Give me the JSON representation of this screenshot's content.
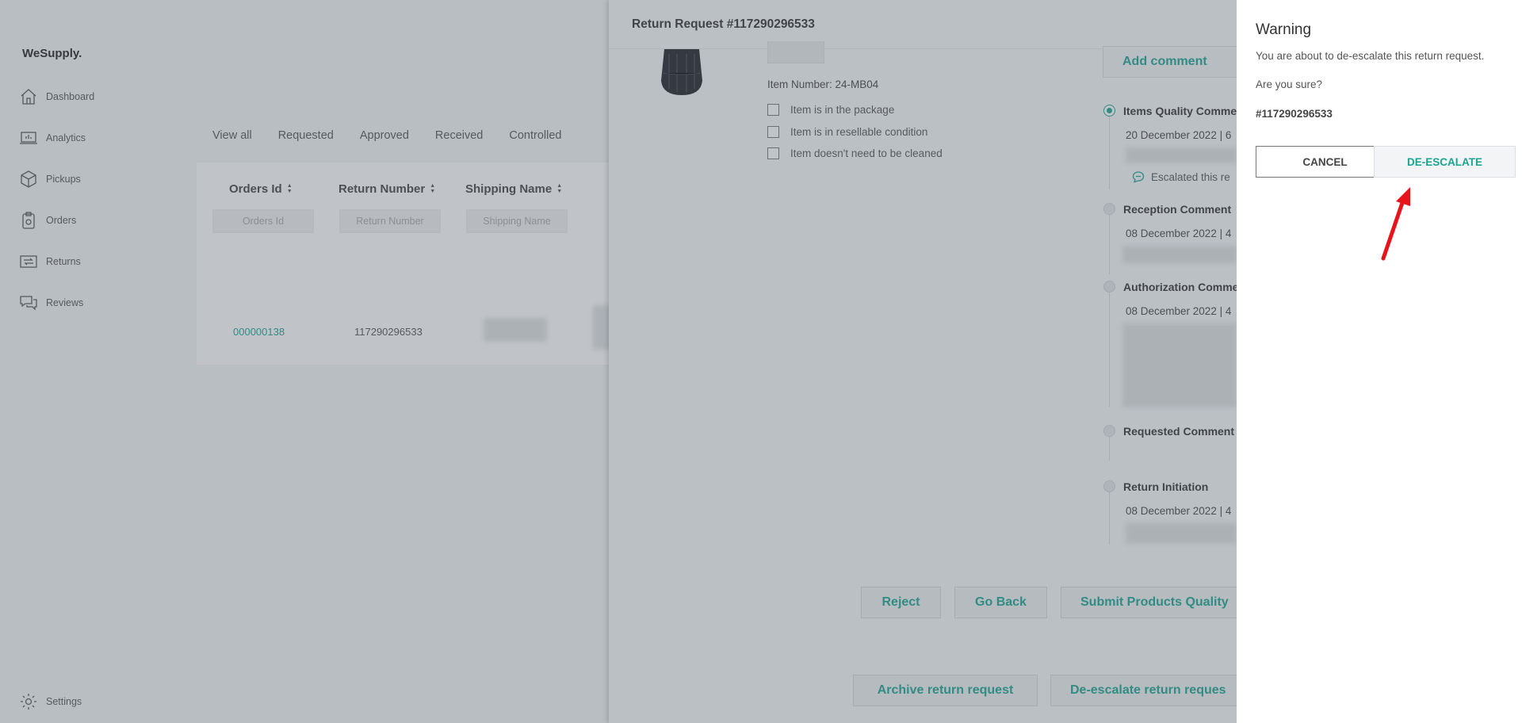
{
  "brand": "WeSupply.",
  "sidebar": {
    "items": [
      {
        "label": "Dashboard",
        "icon": "home-icon"
      },
      {
        "label": "Analytics",
        "icon": "analytics-icon"
      },
      {
        "label": "Pickups",
        "icon": "box-icon"
      },
      {
        "label": "Orders",
        "icon": "clipboard-icon"
      },
      {
        "label": "Returns",
        "icon": "returns-icon"
      },
      {
        "label": "Reviews",
        "icon": "reviews-icon"
      }
    ],
    "settings_label": "Settings"
  },
  "main": {
    "tabs": [
      "View all",
      "Requested",
      "Approved",
      "Received",
      "Controlled"
    ],
    "table": {
      "columns": [
        "Orders Id",
        "Return Number",
        "Shipping Name"
      ],
      "filter_placeholders": [
        "Orders Id",
        "Return Number",
        "Shipping Name"
      ],
      "row": {
        "order_id": "000000138",
        "return_number": "117290296533"
      }
    }
  },
  "panel": {
    "title": "Return Request #117290296533",
    "item_number": "Item Number: 24-MB04",
    "checks": [
      "Item is in the package",
      "Item is in resellable condition",
      "Item doesn't need to be cleaned"
    ],
    "add_comment": "Add comment",
    "timeline": [
      {
        "title": "Items Quality Comme",
        "date": "20 December 2022 | 6"
      },
      {
        "title": "Reception Comment",
        "date": "08 December 2022 | 4"
      },
      {
        "title": "Authorization Comme",
        "date": "08 December 2022 | 4"
      },
      {
        "title": "Requested Comment",
        "date": ""
      },
      {
        "title": "Return Initiation",
        "date": "08 December 2022 | 4"
      }
    ],
    "escalated_text": "Escalated this re",
    "buttons": {
      "reject": "Reject",
      "go_back": "Go Back",
      "submit": "Submit Products Quality",
      "archive": "Archive return request",
      "deescalate": "De-escalate return reques"
    }
  },
  "warning": {
    "title": "Warning",
    "message": "You are about to de-escalate this return request.",
    "question": "Are you sure?",
    "request_id": "#117290296533",
    "cancel": "CANCEL",
    "confirm": "DE-ESCALATE"
  },
  "colors": {
    "accent": "#1aa591",
    "arrow": "#e8141c"
  }
}
